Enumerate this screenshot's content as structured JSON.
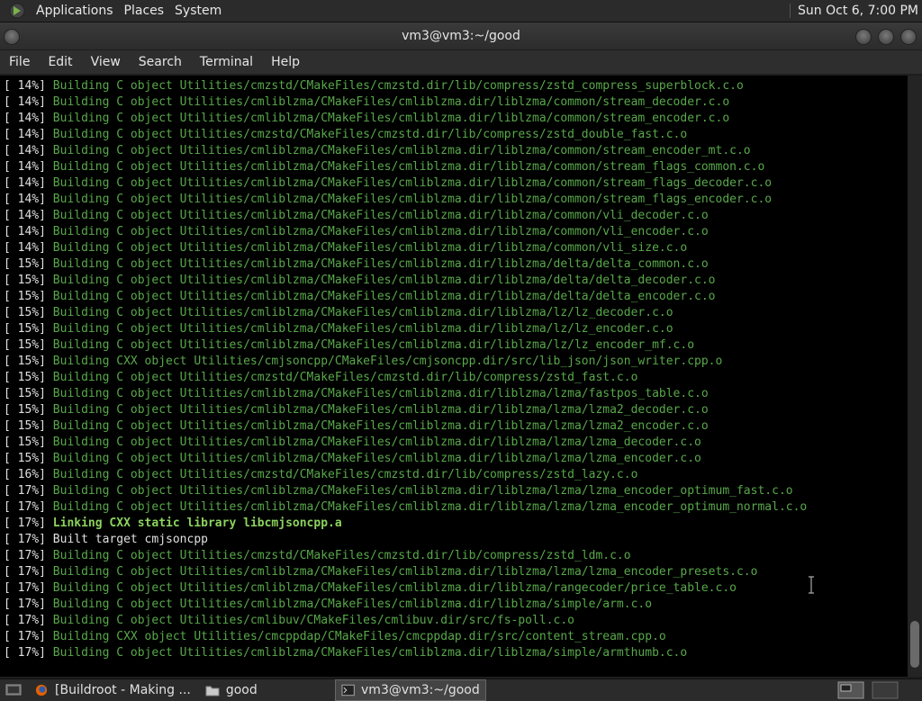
{
  "panel": {
    "menus": [
      "Applications",
      "Places",
      "System"
    ],
    "clock": "Sun Oct  6,  7:00 PM"
  },
  "window": {
    "title": "vm3@vm3:~/good"
  },
  "menubar": [
    "File",
    "Edit",
    "View",
    "Search",
    "Terminal",
    "Help"
  ],
  "terminal": {
    "lines": [
      {
        "pct": "[ 14%]",
        "text": "Building C object Utilities/cmzstd/CMakeFiles/cmzstd.dir/lib/compress/zstd_compress_superblock.c.o",
        "style": "green"
      },
      {
        "pct": "[ 14%]",
        "text": "Building C object Utilities/cmliblzma/CMakeFiles/cmliblzma.dir/liblzma/common/stream_decoder.c.o",
        "style": "green"
      },
      {
        "pct": "[ 14%]",
        "text": "Building C object Utilities/cmliblzma/CMakeFiles/cmliblzma.dir/liblzma/common/stream_encoder.c.o",
        "style": "green"
      },
      {
        "pct": "[ 14%]",
        "text": "Building C object Utilities/cmzstd/CMakeFiles/cmzstd.dir/lib/compress/zstd_double_fast.c.o",
        "style": "green"
      },
      {
        "pct": "[ 14%]",
        "text": "Building C object Utilities/cmliblzma/CMakeFiles/cmliblzma.dir/liblzma/common/stream_encoder_mt.c.o",
        "style": "green"
      },
      {
        "pct": "[ 14%]",
        "text": "Building C object Utilities/cmliblzma/CMakeFiles/cmliblzma.dir/liblzma/common/stream_flags_common.c.o",
        "style": "green"
      },
      {
        "pct": "[ 14%]",
        "text": "Building C object Utilities/cmliblzma/CMakeFiles/cmliblzma.dir/liblzma/common/stream_flags_decoder.c.o",
        "style": "green"
      },
      {
        "pct": "[ 14%]",
        "text": "Building C object Utilities/cmliblzma/CMakeFiles/cmliblzma.dir/liblzma/common/stream_flags_encoder.c.o",
        "style": "green"
      },
      {
        "pct": "[ 14%]",
        "text": "Building C object Utilities/cmliblzma/CMakeFiles/cmliblzma.dir/liblzma/common/vli_decoder.c.o",
        "style": "green"
      },
      {
        "pct": "[ 14%]",
        "text": "Building C object Utilities/cmliblzma/CMakeFiles/cmliblzma.dir/liblzma/common/vli_encoder.c.o",
        "style": "green"
      },
      {
        "pct": "[ 14%]",
        "text": "Building C object Utilities/cmliblzma/CMakeFiles/cmliblzma.dir/liblzma/common/vli_size.c.o",
        "style": "green"
      },
      {
        "pct": "[ 15%]",
        "text": "Building C object Utilities/cmliblzma/CMakeFiles/cmliblzma.dir/liblzma/delta/delta_common.c.o",
        "style": "green"
      },
      {
        "pct": "[ 15%]",
        "text": "Building C object Utilities/cmliblzma/CMakeFiles/cmliblzma.dir/liblzma/delta/delta_decoder.c.o",
        "style": "green"
      },
      {
        "pct": "[ 15%]",
        "text": "Building C object Utilities/cmliblzma/CMakeFiles/cmliblzma.dir/liblzma/delta/delta_encoder.c.o",
        "style": "green"
      },
      {
        "pct": "[ 15%]",
        "text": "Building C object Utilities/cmliblzma/CMakeFiles/cmliblzma.dir/liblzma/lz/lz_decoder.c.o",
        "style": "green"
      },
      {
        "pct": "[ 15%]",
        "text": "Building C object Utilities/cmliblzma/CMakeFiles/cmliblzma.dir/liblzma/lz/lz_encoder.c.o",
        "style": "green"
      },
      {
        "pct": "[ 15%]",
        "text": "Building C object Utilities/cmliblzma/CMakeFiles/cmliblzma.dir/liblzma/lz/lz_encoder_mf.c.o",
        "style": "green"
      },
      {
        "pct": "[ 15%]",
        "text": "Building CXX object Utilities/cmjsoncpp/CMakeFiles/cmjsoncpp.dir/src/lib_json/json_writer.cpp.o",
        "style": "green"
      },
      {
        "pct": "[ 15%]",
        "text": "Building C object Utilities/cmzstd/CMakeFiles/cmzstd.dir/lib/compress/zstd_fast.c.o",
        "style": "green"
      },
      {
        "pct": "[ 15%]",
        "text": "Building C object Utilities/cmliblzma/CMakeFiles/cmliblzma.dir/liblzma/lzma/fastpos_table.c.o",
        "style": "green"
      },
      {
        "pct": "[ 15%]",
        "text": "Building C object Utilities/cmliblzma/CMakeFiles/cmliblzma.dir/liblzma/lzma/lzma2_decoder.c.o",
        "style": "green"
      },
      {
        "pct": "[ 15%]",
        "text": "Building C object Utilities/cmliblzma/CMakeFiles/cmliblzma.dir/liblzma/lzma/lzma2_encoder.c.o",
        "style": "green"
      },
      {
        "pct": "[ 15%]",
        "text": "Building C object Utilities/cmliblzma/CMakeFiles/cmliblzma.dir/liblzma/lzma/lzma_decoder.c.o",
        "style": "green"
      },
      {
        "pct": "[ 15%]",
        "text": "Building C object Utilities/cmliblzma/CMakeFiles/cmliblzma.dir/liblzma/lzma/lzma_encoder.c.o",
        "style": "green"
      },
      {
        "pct": "[ 16%]",
        "text": "Building C object Utilities/cmzstd/CMakeFiles/cmzstd.dir/lib/compress/zstd_lazy.c.o",
        "style": "green"
      },
      {
        "pct": "[ 17%]",
        "text": "Building C object Utilities/cmliblzma/CMakeFiles/cmliblzma.dir/liblzma/lzma/lzma_encoder_optimum_fast.c.o",
        "style": "green"
      },
      {
        "pct": "[ 17%]",
        "text": "Building C object Utilities/cmliblzma/CMakeFiles/cmliblzma.dir/liblzma/lzma/lzma_encoder_optimum_normal.c.o",
        "style": "green"
      },
      {
        "pct": "[ 17%]",
        "text": "Linking CXX static library libcmjsoncpp.a",
        "style": "bold"
      },
      {
        "pct": "[ 17%]",
        "text": "Built target cmjsoncpp",
        "style": "white"
      },
      {
        "pct": "[ 17%]",
        "text": "Building C object Utilities/cmzstd/CMakeFiles/cmzstd.dir/lib/compress/zstd_ldm.c.o",
        "style": "green"
      },
      {
        "pct": "[ 17%]",
        "text": "Building C object Utilities/cmliblzma/CMakeFiles/cmliblzma.dir/liblzma/lzma/lzma_encoder_presets.c.o",
        "style": "green"
      },
      {
        "pct": "[ 17%]",
        "text": "Building C object Utilities/cmliblzma/CMakeFiles/cmliblzma.dir/liblzma/rangecoder/price_table.c.o",
        "style": "green"
      },
      {
        "pct": "[ 17%]",
        "text": "Building C object Utilities/cmliblzma/CMakeFiles/cmliblzma.dir/liblzma/simple/arm.c.o",
        "style": "green"
      },
      {
        "pct": "[ 17%]",
        "text": "Building C object Utilities/cmlibuv/CMakeFiles/cmlibuv.dir/src/fs-poll.c.o",
        "style": "green"
      },
      {
        "pct": "[ 17%]",
        "text": "Building CXX object Utilities/cmcppdap/CMakeFiles/cmcppdap.dir/src/content_stream.cpp.o",
        "style": "green"
      },
      {
        "pct": "[ 17%]",
        "text": "Building C object Utilities/cmliblzma/CMakeFiles/cmliblzma.dir/liblzma/simple/armthumb.c.o",
        "style": "green"
      }
    ]
  },
  "taskbar": {
    "items": [
      {
        "label": "[Buildroot - Making ...",
        "icon": "firefox-icon"
      },
      {
        "label": "good",
        "icon": "folder-icon"
      },
      {
        "label": "vm3@vm3:~/good",
        "icon": "terminal-icon"
      }
    ]
  },
  "colors": {
    "terminal_bg": "#000000",
    "build_green": "#58a84a",
    "link_green": "#8cd35e",
    "panel_bg": "#2b2b2b"
  }
}
